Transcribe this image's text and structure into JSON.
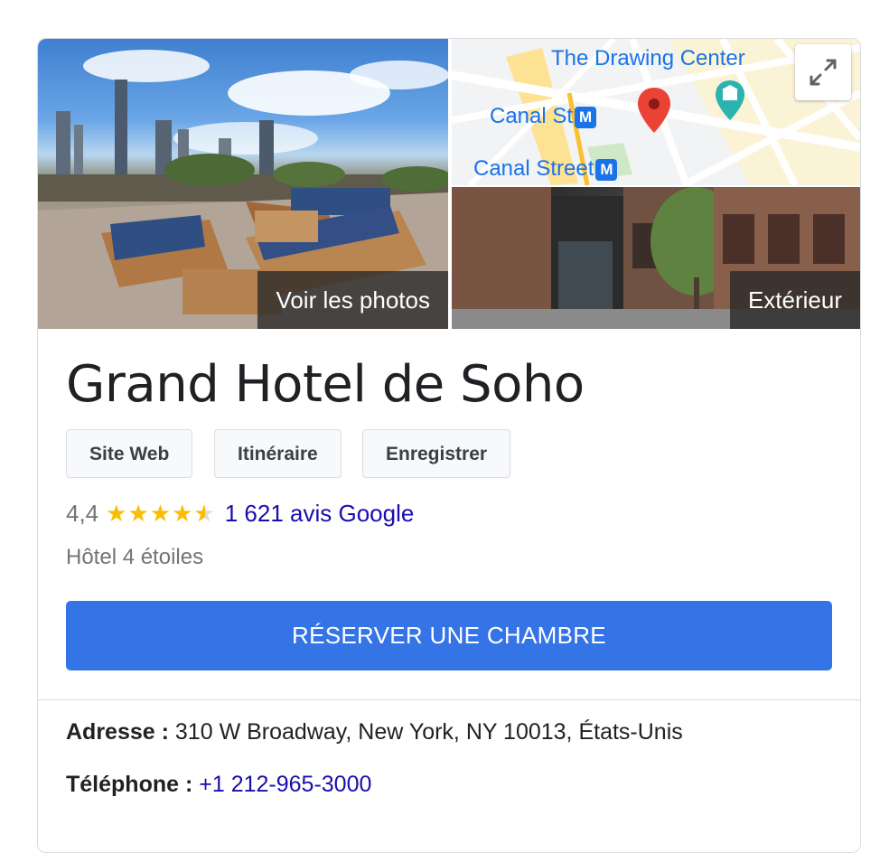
{
  "photos": {
    "main_label": "Voir les photos",
    "street_label": "Extérieur"
  },
  "map": {
    "labels": {
      "drawing_center": "The Drawing Center",
      "canal_st": "Canal St",
      "canal_street": "Canal Street"
    },
    "metro_symbol": "M",
    "expand_icon": "expand-icon",
    "pin_icon": "map-pin-icon",
    "museum_icon": "museum-icon"
  },
  "hotel": {
    "name": "Grand Hotel de Soho",
    "rating": "4,4",
    "stars": 4.4,
    "reviews_link": "1 621 avis Google",
    "category": "Hôtel 4 étoiles"
  },
  "actions": {
    "website": "Site Web",
    "directions": "Itinéraire",
    "save": "Enregistrer"
  },
  "book_button": "RÉSERVER UNE CHAMBRE",
  "info": {
    "address_label": "Adresse :",
    "address_value": "310 W Broadway, New York, NY 10013, États-Unis",
    "phone_label": "Téléphone :",
    "phone_value": "+1 212-965-3000"
  },
  "colors": {
    "accent": "#3574e6",
    "link": "#1a0dab",
    "star": "#fbbc04",
    "map_pin": "#ea4335",
    "museum": "#2cb3b0"
  }
}
